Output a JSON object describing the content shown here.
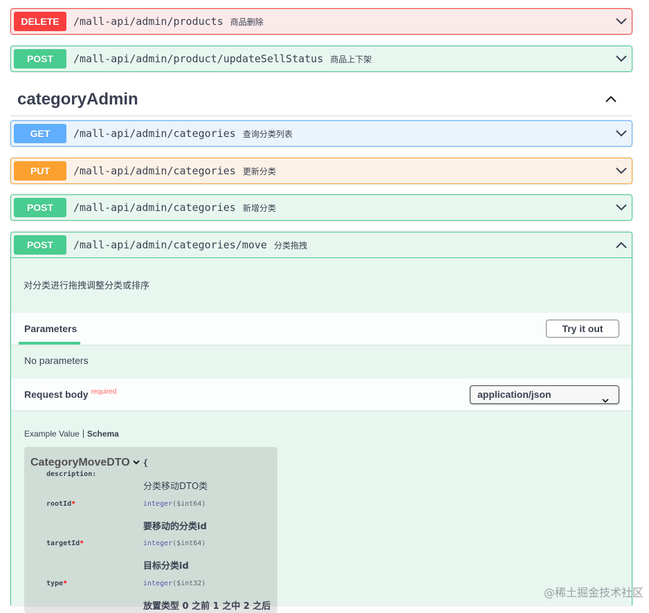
{
  "top_operations": [
    {
      "method": "DELETE",
      "path": "/mall-api/admin/products",
      "summary": "商品删除"
    },
    {
      "method": "POST",
      "path": "/mall-api/admin/product/updateSellStatus",
      "summary": "商品上下架"
    }
  ],
  "tag": {
    "name": "categoryAdmin"
  },
  "category_operations": [
    {
      "method": "GET",
      "path": "/mall-api/admin/categories",
      "summary": "查询分类列表"
    },
    {
      "method": "PUT",
      "path": "/mall-api/admin/categories",
      "summary": "更新分类"
    },
    {
      "method": "POST",
      "path": "/mall-api/admin/categories",
      "summary": "新增分类"
    }
  ],
  "expanded_operation": {
    "method": "POST",
    "path": "/mall-api/admin/categories/move",
    "summary": "分类拖拽",
    "description": "对分类进行拖拽调整分类或排序",
    "parameters_title": "Parameters",
    "try_label": "Try it out",
    "no_params": "No parameters",
    "request_body_title": "Request body",
    "required_label": "required",
    "content_type": "application/json",
    "example_tab": "Example Value",
    "schema_tab": "Schema",
    "model": {
      "name": "CategoryMoveDTO",
      "open_brace": "{",
      "description_label": "description:",
      "description_value": "分类移动DTO类",
      "properties": [
        {
          "name": "rootId",
          "required_mark": "*",
          "type": "integer",
          "format": "($int64)",
          "desc": "要移动的分类id"
        },
        {
          "name": "targetId",
          "required_mark": "*",
          "type": "integer",
          "format": "($int64)",
          "desc": "目标分类id"
        },
        {
          "name": "type",
          "required_mark": "*",
          "type": "integer",
          "format": "($int32)",
          "desc": "放置类型 0 之前 1 之中 2 之后"
        }
      ]
    }
  },
  "watermark": "@稀土掘金技术社区",
  "colors": {
    "delete": "#f93e3e",
    "post": "#49cc90",
    "get": "#61affe",
    "put": "#fca130"
  }
}
